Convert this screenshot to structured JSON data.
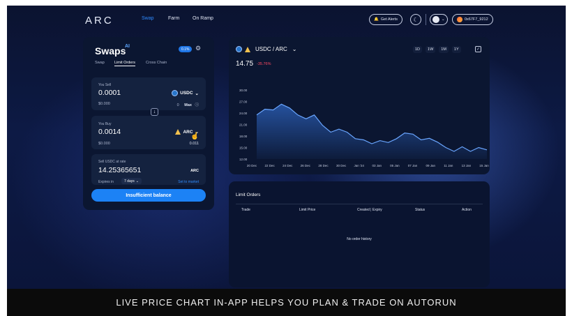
{
  "nav": {
    "logo": "ARC",
    "links": [
      "Swap",
      "Farm",
      "On Ramp"
    ],
    "get_alerts": "Get Alerts",
    "wallet": "0x67F7_9212"
  },
  "swap": {
    "title": "Swaps",
    "ai_mark": "AI",
    "slippage": "0.1%",
    "tabs": [
      "Swap",
      "Limit Orders",
      "Cross Chain"
    ],
    "sell": {
      "label": "You Sell",
      "amount": "0.0001",
      "token": "USDC",
      "usd": "$0.000",
      "balance": "0",
      "max": "Max"
    },
    "buy": {
      "label": "You Buy",
      "amount": "0.0014",
      "token": "ARC",
      "usd": "$0.000",
      "balance": "0.011"
    },
    "rate": {
      "label": "Sell USDC at rate",
      "value": "14.25365651",
      "unit": "ARC",
      "expires_label": "Expires in",
      "expires_value": "7 days",
      "set_market": "Set to market"
    },
    "cta": "Insufficient balance"
  },
  "chart": {
    "pair": "USDC / ARC",
    "price": "14.75",
    "change": "-35.76%",
    "ranges": [
      "1D",
      "1W",
      "1M",
      "1Y"
    ]
  },
  "chart_data": {
    "type": "area",
    "title": "",
    "xlabel": "",
    "ylabel": "",
    "x_tick_labels": [
      "20 Dec",
      "22 Dec",
      "24 Dec",
      "26 Dec",
      "28 Dec",
      "30 Dec",
      "Jan '24",
      "03 Jan",
      "05 Jan",
      "07 Jan",
      "09 Jan",
      "11 Jan",
      "13 Jan",
      "15 Jan"
    ],
    "y_tick_labels": [
      "30.00",
      "27.00",
      "24.00",
      "21.00",
      "18.00",
      "15.00",
      "12.00"
    ],
    "ylim": [
      12,
      30
    ],
    "color": "#3b82f6",
    "values": [
      23.5,
      25.0,
      24.8,
      26.3,
      25.3,
      23.5,
      22.5,
      23.5,
      20.8,
      19.0,
      19.8,
      19.0,
      17.3,
      17.0,
      16.0,
      16.8,
      16.3,
      17.3,
      18.8,
      18.5,
      17.0,
      17.4,
      16.4,
      15.0,
      14.0,
      15.2,
      14.0,
      15.0,
      14.4
    ]
  },
  "orders": {
    "title": "Limit Orders",
    "columns": [
      "Trade",
      "Limit Price",
      "Created | Expiry",
      "Status",
      "Action"
    ],
    "empty": "No order history"
  },
  "caption": "LIVE PRICE CHART IN-APP HELPS YOU PLAN & TRADE ON AUTORUN"
}
